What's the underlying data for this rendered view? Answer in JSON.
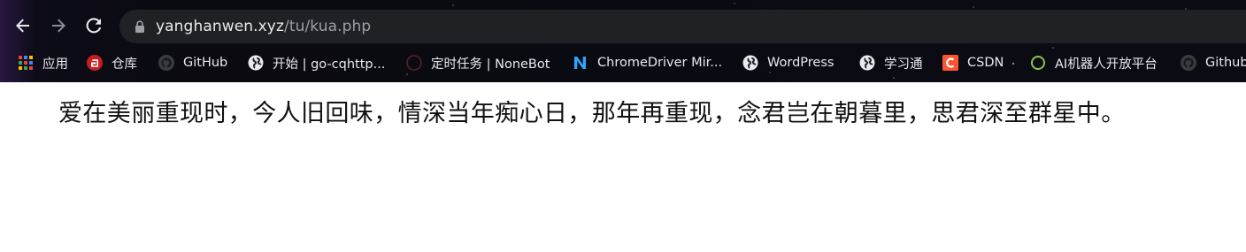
{
  "browser": {
    "url_host": "yanghanwen.xyz",
    "url_path": "/tu/kua.php",
    "bookmarks": [
      {
        "label": "应用",
        "icon": "apps-grid-icon"
      },
      {
        "label": "仓库",
        "icon": "gitee-icon"
      },
      {
        "label": "GitHub",
        "icon": "github-icon"
      },
      {
        "label": "开始 | go-cqhttp...",
        "icon": "globe-icon"
      },
      {
        "label": "定时任务 | NoneBot",
        "icon": "nonebot-icon"
      },
      {
        "label": "ChromeDriver Mir...",
        "icon": "chromedriver-icon"
      },
      {
        "label": "WordPress",
        "icon": "globe-icon"
      },
      {
        "label": "学习通",
        "icon": "globe-icon"
      },
      {
        "label": "CSDN",
        "icon": "csdn-icon"
      },
      {
        "label": "AI机器人开放平台",
        "icon": "ai-ring-icon"
      },
      {
        "label": "Github",
        "icon": "github-icon"
      }
    ]
  },
  "page": {
    "text": "爱在美丽重现时，今人旧回味，情深当年痴心日，那年再重现，念君岂在朝暮里，思君深至群星中。"
  }
}
